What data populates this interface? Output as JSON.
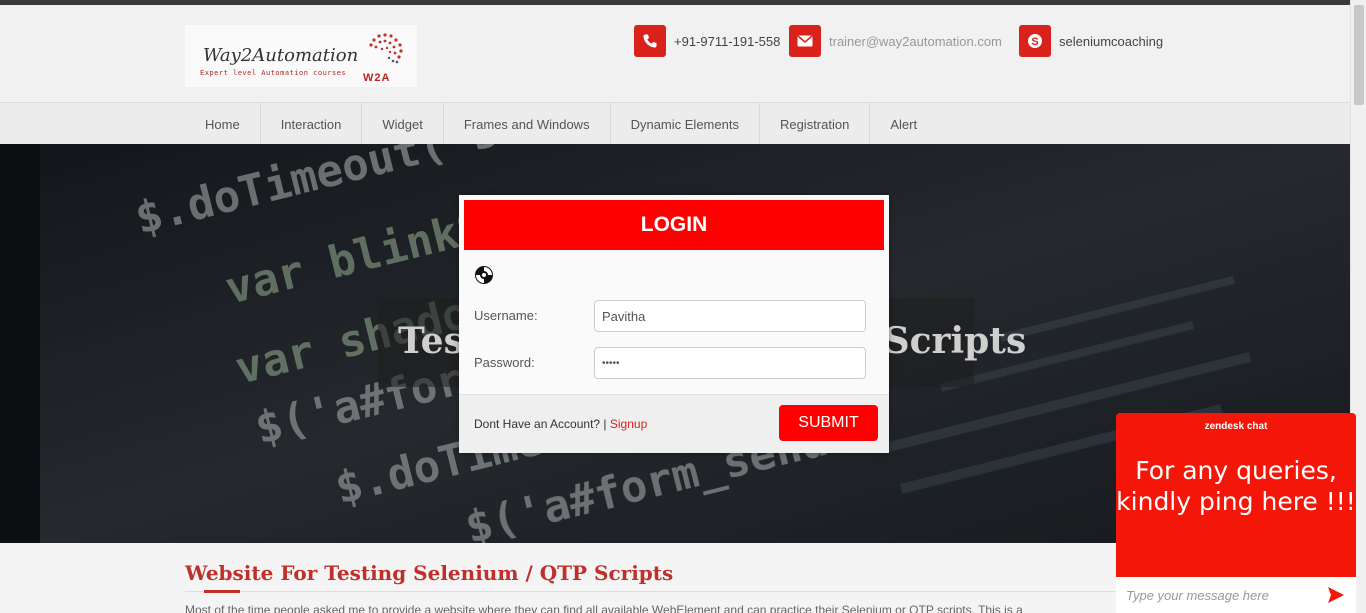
{
  "header": {
    "logo_title": "Way2Automation",
    "logo_tagline": "Expert level Automation courses",
    "logo_mark_text": "W2A",
    "contacts": [
      {
        "icon": "phone-icon",
        "text": "+91-9711-191-558"
      },
      {
        "icon": "mail-icon",
        "text": "trainer@way2automation.com"
      },
      {
        "icon": "skype-icon",
        "text": "seleniumcoaching"
      }
    ]
  },
  "nav": {
    "items": [
      "Home",
      "Interaction",
      "Widget",
      "Frames and Windows",
      "Dynamic Elements",
      "Registration",
      "Alert"
    ]
  },
  "hero": {
    "title": "Testing Selenium / QTP Scripts"
  },
  "content": {
    "title": "Website For Testing Selenium / QTP Scripts",
    "paragraph": "Most of the time people asked me to provide a website where they can find all available WebElement and can practice their Selenium or QTP scripts. This is a"
  },
  "modal": {
    "title": "LOGIN",
    "username_label": "Username:",
    "username_value": "Pavitha",
    "password_label": "Password:",
    "password_value": "•••••",
    "no_account_text": "Dont Have an Account? |",
    "signup_link": "Signup",
    "submit_label": "SUBMIT"
  },
  "zendesk": {
    "brand": "zendesk chat",
    "message": "For any queries, kindly ping here !!!",
    "input_placeholder": "Type your message here"
  },
  "colors": {
    "accent_red": "#ff0000",
    "brand_red": "#d9221b",
    "title_red": "#c0302a"
  }
}
